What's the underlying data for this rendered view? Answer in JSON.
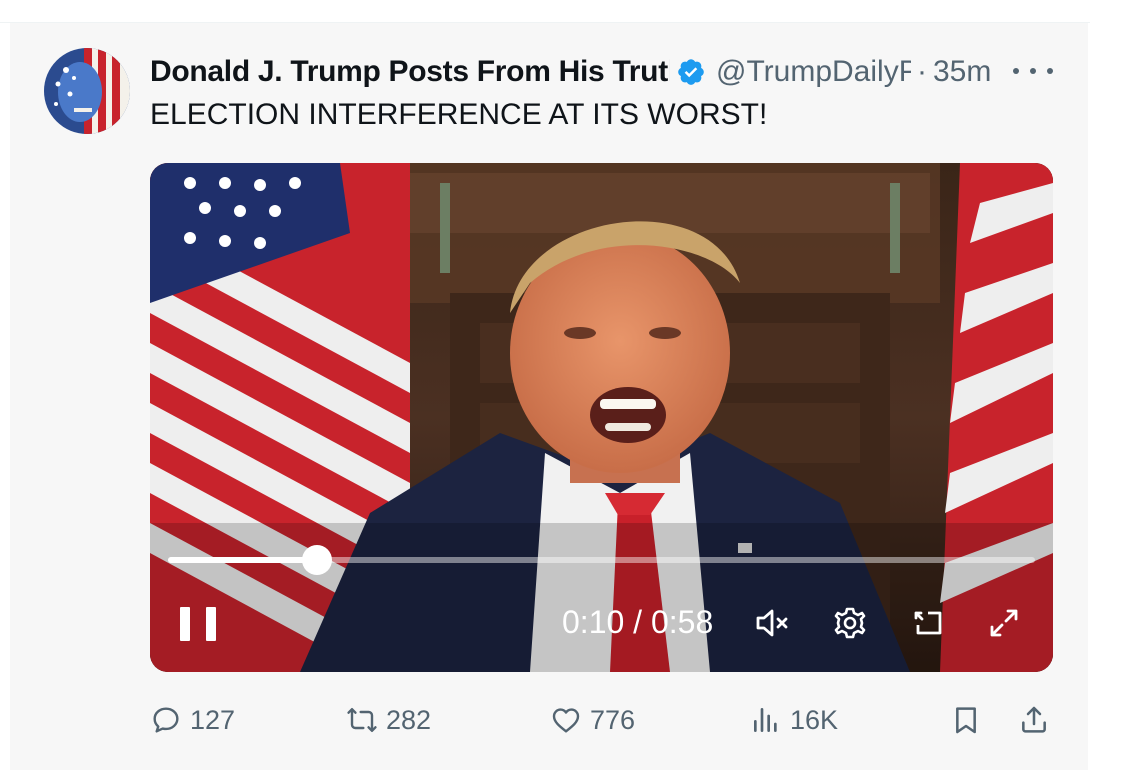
{
  "tweet": {
    "display_name": "Donald J. Trump Posts From His Truth Social",
    "handle": "@TrumpDailyPosts",
    "separator": "·",
    "time": "35m",
    "text": "ELECTION INTERFERENCE AT ITS WORST!"
  },
  "video": {
    "current_time": "0:10",
    "duration": "0:58",
    "time_label": "0:10 / 0:58",
    "progress_fraction": 0.172,
    "muted": true
  },
  "actions": {
    "replies": "127",
    "reposts": "282",
    "likes": "776",
    "views": "16K"
  },
  "icons": {
    "verified": "verified-badge-icon",
    "more": "more-options-icon",
    "pause": "pause-icon",
    "mute": "volume-muted-icon",
    "settings": "settings-gear-icon",
    "cast": "cast-icon",
    "fullscreen": "fullscreen-icon",
    "reply": "reply-bubble-icon",
    "repost": "repost-icon",
    "like": "heart-icon",
    "views": "views-bar-chart-icon",
    "bookmark": "bookmark-icon",
    "share": "share-icon"
  },
  "colors": {
    "verified_blue": "#1d9bf0",
    "text_primary": "#0f1419",
    "text_secondary": "#536471",
    "background": "#f7f7f7"
  }
}
